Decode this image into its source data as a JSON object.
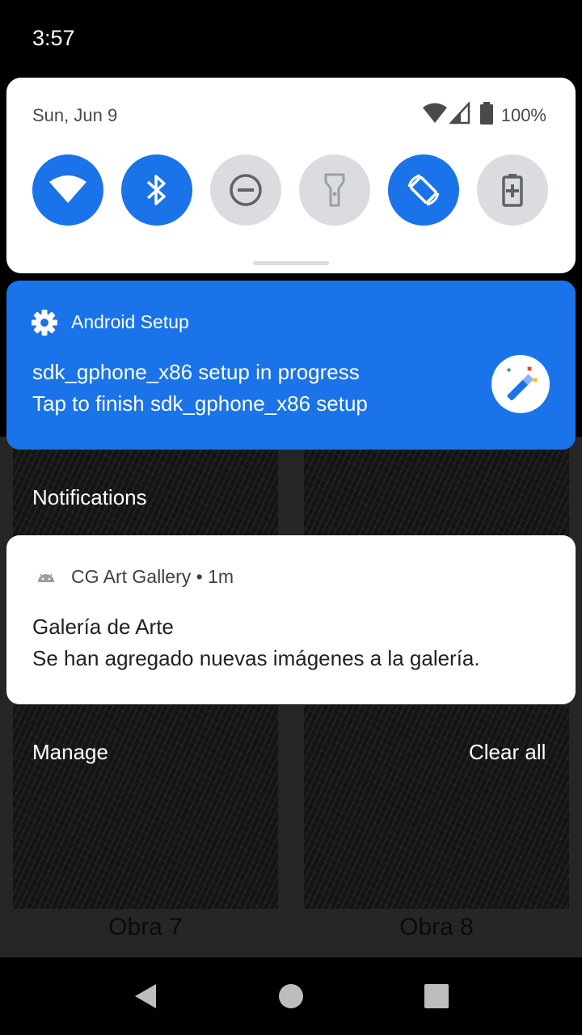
{
  "status_bar": {
    "time": "3:57"
  },
  "quick_settings": {
    "date": "Sun, Jun 9",
    "battery_text": "100%",
    "tiles": [
      {
        "name": "wifi",
        "state": "on",
        "icon": "wifi-icon"
      },
      {
        "name": "bluetooth",
        "state": "on",
        "icon": "bluetooth-icon"
      },
      {
        "name": "do-not-disturb",
        "state": "off",
        "icon": "do-not-disturb-icon"
      },
      {
        "name": "flashlight",
        "state": "off",
        "icon": "flashlight-icon"
      },
      {
        "name": "auto-rotate",
        "state": "on",
        "icon": "auto-rotate-icon"
      },
      {
        "name": "battery-saver",
        "state": "off",
        "icon": "battery-saver-icon"
      }
    ]
  },
  "setup_notification": {
    "app": "Android Setup",
    "title": "sdk_gphone_x86 setup in progress",
    "text": "Tap to finish sdk_gphone_x86 setup",
    "icon": "setup-wand-icon"
  },
  "notifications_header": "Notifications",
  "gallery_notification": {
    "app": "CG Art Gallery",
    "time": "1m",
    "title": "Galería de Arte",
    "text": "Se han agregado nuevas imágenes a la galería."
  },
  "footer": {
    "manage": "Manage",
    "clear_all": "Clear all"
  },
  "gallery": {
    "labels": [
      "Obra 7",
      "Obra 8"
    ]
  },
  "colors": {
    "accent": "#1a73e8",
    "tile_off": "#dadce0",
    "panel": "#ffffff"
  }
}
